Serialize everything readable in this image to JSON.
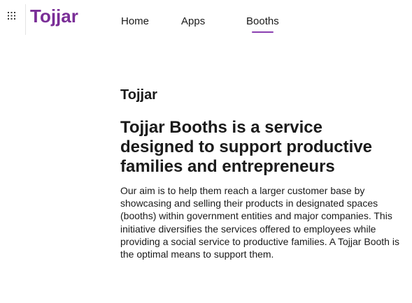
{
  "header": {
    "app_launcher_icon": "waffle-grid-icon",
    "brand": "Tojjar",
    "brand_color": "#7a2e97",
    "accent_color": "#8a3fb0"
  },
  "nav": {
    "items": [
      {
        "label": "Home",
        "active": false
      },
      {
        "label": "Apps",
        "active": false
      },
      {
        "label": "Booths",
        "active": true
      }
    ]
  },
  "main": {
    "site_name": "Tojjar",
    "headline": "Tojjar Booths is a service designed to support productive families and entrepreneurs",
    "body": "Our aim is to help them reach a larger customer base by showcasing and selling their products in designated spaces (booths) within government entities and major companies. This initiative diversifies the services offered to employees while providing a social service to productive families. A Tojjar Booth is the optimal means to support them."
  }
}
